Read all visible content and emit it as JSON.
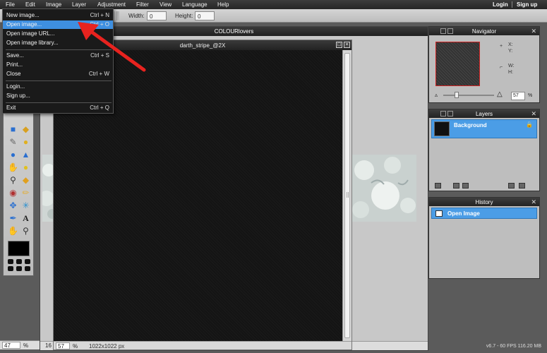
{
  "menubar": {
    "items": [
      "File",
      "Edit",
      "Image",
      "Layer",
      "Adjustment",
      "Filter",
      "View",
      "Language",
      "Help"
    ],
    "login": "Login",
    "signup": "Sign up"
  },
  "optbar": {
    "width_label": "Width:",
    "width_value": "0",
    "height_label": "Height:",
    "height_value": "0"
  },
  "file_menu": {
    "items": [
      {
        "label": "New image...",
        "shortcut": "Ctrl + N"
      },
      {
        "label": "Open image...",
        "shortcut": "Ctrl + O"
      },
      {
        "label": "Open image URL...",
        "shortcut": ""
      },
      {
        "label": "Open image library...",
        "shortcut": ""
      },
      {
        "label": "Save...",
        "shortcut": "Ctrl + S"
      },
      {
        "label": "Print...",
        "shortcut": ""
      },
      {
        "label": "Close",
        "shortcut": "Ctrl + W"
      },
      {
        "label": "Login...",
        "shortcut": ""
      },
      {
        "label": "Sign up...",
        "shortcut": ""
      },
      {
        "label": "Exit",
        "shortcut": "Ctrl + Q"
      }
    ]
  },
  "doc_back": {
    "title": "COLOURlovers"
  },
  "doc_front": {
    "title": "darth_stripe_@2X",
    "zoom": "57",
    "zoom_unit": "%",
    "dimensions": "1022x1022 px"
  },
  "left_status": {
    "zoom": "47",
    "zoom_unit": "%",
    "extra": "16"
  },
  "navigator": {
    "title": "Navigator",
    "x_label": "X:",
    "y_label": "Y:",
    "w_label": "W:",
    "h_label": "H:",
    "zoom": "57",
    "zoom_unit": "%"
  },
  "layers": {
    "title": "Layers",
    "layer_name": "Background"
  },
  "history": {
    "title": "History",
    "entry": "Open Image"
  },
  "footer": {
    "fps": "v6.7 - 60 FPS 116.20 MB"
  },
  "colors": {
    "accent": "#3e8fe0",
    "arrow": "#e8231f",
    "panel_bg": "#bebebe"
  }
}
